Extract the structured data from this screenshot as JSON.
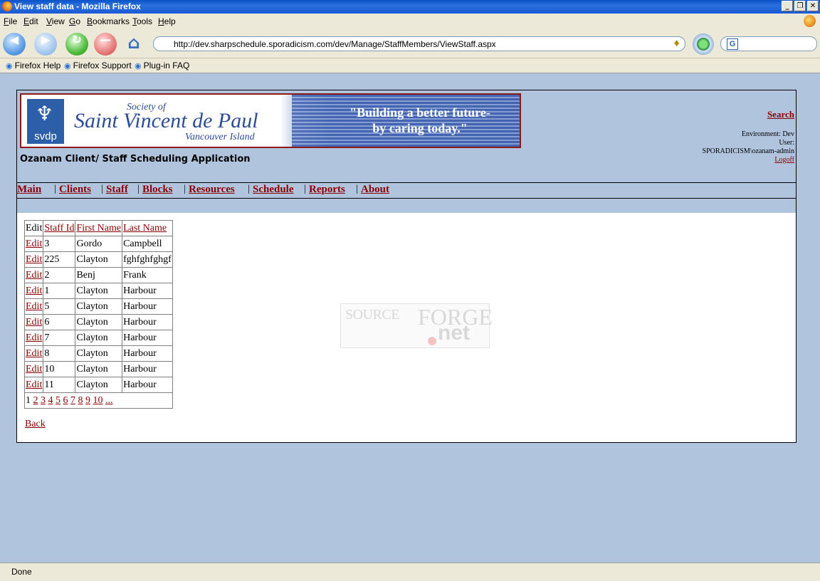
{
  "window": {
    "title": "View staff data - Mozilla Firefox"
  },
  "menubar": [
    {
      "accesskey": "F",
      "rest": "ile"
    },
    {
      "accesskey": "E",
      "rest": "dit"
    },
    {
      "accesskey": "V",
      "rest": "iew"
    },
    {
      "accesskey": "G",
      "rest": "o"
    },
    {
      "accesskey": "B",
      "rest": "ookmarks"
    },
    {
      "accesskey": "T",
      "rest": "ools"
    },
    {
      "accesskey": "H",
      "rest": "elp"
    }
  ],
  "toolbar": {
    "url": "http://dev.sharpschedule.sporadicism.com/dev/Manage/StaffMembers/ViewStaff.aspx",
    "search_value": ""
  },
  "bookmarks": [
    "Firefox Help",
    "Firefox Support",
    "Plug-in FAQ"
  ],
  "banner": {
    "logo_text": "svdp",
    "society": "Society of",
    "name": "Saint Vincent de Paul",
    "region": "Vancouver Island",
    "slogan_line1": "\"Building a better future-",
    "slogan_line2": "by caring today.\""
  },
  "app_title": "Ozanam Client/ Staff Scheduling Application",
  "right_info": {
    "search_label": "Search",
    "environment": "Environment: Dev",
    "user_label": "User:",
    "user_value": "SPORADICISM\\ozanam-admin",
    "logoff_label": "Logoff"
  },
  "nav": [
    "Main",
    "Clients",
    "Staff",
    "Blocks",
    "Resources",
    "Schedule",
    "Reports",
    "About"
  ],
  "table": {
    "headers": [
      "Edit",
      "Staff Id",
      "First Name",
      "Last Name"
    ],
    "rows": [
      {
        "edit": "Edit",
        "id": "3",
        "first": "Gordo",
        "last": "Campbell"
      },
      {
        "edit": "Edit",
        "id": "225",
        "first": "Clayton",
        "last": "fghfghfghgf"
      },
      {
        "edit": "Edit",
        "id": "2",
        "first": "Benj",
        "last": "Frank"
      },
      {
        "edit": "Edit",
        "id": "1",
        "first": "Clayton",
        "last": "Harbour"
      },
      {
        "edit": "Edit",
        "id": "5",
        "first": "Clayton",
        "last": "Harbour"
      },
      {
        "edit": "Edit",
        "id": "6",
        "first": "Clayton",
        "last": "Harbour"
      },
      {
        "edit": "Edit",
        "id": "7",
        "first": "Clayton",
        "last": "Harbour"
      },
      {
        "edit": "Edit",
        "id": "8",
        "first": "Clayton",
        "last": "Harbour"
      },
      {
        "edit": "Edit",
        "id": "10",
        "first": "Clayton",
        "last": "Harbour"
      },
      {
        "edit": "Edit",
        "id": "11",
        "first": "Clayton",
        "last": "Harbour"
      }
    ],
    "pager_current": "1",
    "pager_links": [
      "2",
      "3",
      "4",
      "5",
      "6",
      "7",
      "8",
      "9",
      "10",
      "..."
    ]
  },
  "back_label": "Back",
  "watermark": {
    "part1": "SOURCE",
    "part2": "FORGE",
    "part3": "net"
  },
  "status": "Done",
  "colors": {
    "link": "#8b0000",
    "page_bg": "#b0c4de",
    "banner_border": "#8b1a1a"
  }
}
